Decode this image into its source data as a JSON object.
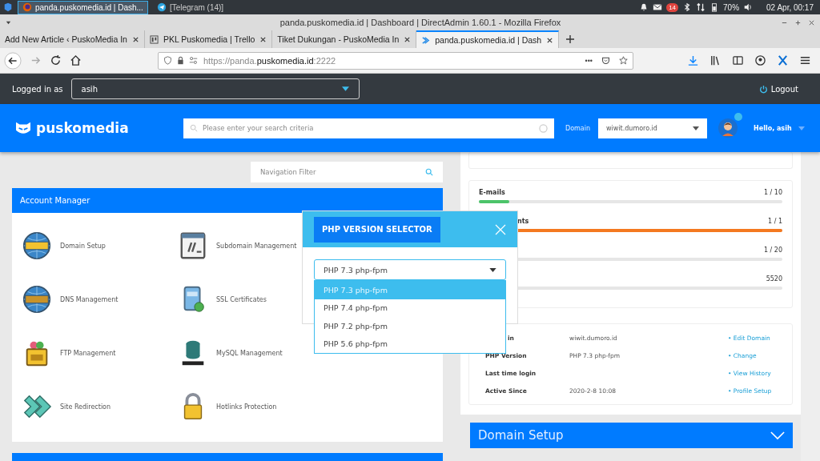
{
  "taskbar": {
    "tasks": [
      {
        "label": "panda.puskomedia.id | Dash...",
        "selected": true
      },
      {
        "label": "[Telegram (14)]",
        "selected": false
      }
    ],
    "notification_count": "14",
    "battery": "70%",
    "clock": "02 Apr, 00:17"
  },
  "window": {
    "title": "panda.puskomedia.id | Dashboard | DirectAdmin 1.60.1 - Mozilla Firefox"
  },
  "tabs": [
    {
      "label": "Add New Article ‹ PuskoMedia In",
      "selected": false
    },
    {
      "label": "PKL Puskomedia | Trello",
      "selected": false
    },
    {
      "label": "Tiket Dukungan - PuskoMedia In",
      "selected": false
    },
    {
      "label": "panda.puskomedia.id | Dash",
      "selected": true
    }
  ],
  "address_bar": {
    "url_start": "https://panda.",
    "url_domain": "puskomedia.id",
    "url_end": ":2222",
    "more": "•••"
  },
  "admin_bar": {
    "label": "Logged in as",
    "user": "asih",
    "logout": "Logout"
  },
  "header": {
    "brand": "puskomedia",
    "search_placeholder": "Please enter your search criteria",
    "domain_label": "Domain",
    "domain": "wiwit.dumoro.id",
    "greeting": "Hello, asih"
  },
  "navigation_filter": {
    "placeholder": "Navigation Filter"
  },
  "account_manager": {
    "title": "Account Manager",
    "items": [
      {
        "label": "Domain Setup",
        "kind": "www"
      },
      {
        "label": "Subdomain Management",
        "kind": "window"
      },
      {
        "label": "DNS Management",
        "kind": "dns"
      },
      {
        "label": "SSL Certificates",
        "kind": "ssl"
      },
      {
        "label": "FTP Management",
        "kind": "ftp"
      },
      {
        "label": "MySQL Management",
        "kind": "mysql"
      },
      {
        "label": "Site Redirection",
        "kind": "redirect"
      },
      {
        "label": "Hotlinks Protection",
        "kind": "lock"
      }
    ]
  },
  "usage": [
    {
      "label": "E-mails",
      "value": "1 / 10",
      "level": 0.1,
      "color": "#4cc46a"
    },
    {
      "label": "nts",
      "clipped": true,
      "value": "1 / 1",
      "level": 1,
      "color": "#f47920"
    },
    {
      "value": "1 / 20",
      "level": 0
    },
    {
      "value": "5520",
      "level": 0
    }
  ],
  "account_info": [
    {
      "label": "in",
      "clipped": true,
      "value": "wiwit.dumoro.id",
      "link": "• Edit Domain"
    },
    {
      "label": "PHP Version",
      "value": "PHP 7.3 php-fpm",
      "link": "• Change"
    },
    {
      "label": "Last time login",
      "link": "• View History"
    },
    {
      "label": "Active Since",
      "value": "2020-2-8 10:08",
      "link": "• Profile Setup"
    }
  ],
  "domain_setup_panel": {
    "title": "Domain Setup"
  },
  "modal": {
    "title": "PHP VERSION SELECTOR",
    "select": {
      "value": "PHP 7.3 php-fpm",
      "expanded": true
    },
    "options": [
      {
        "label": "PHP 7.3 php-fpm",
        "selected": true
      },
      {
        "label": "PHP 7.4 php-fpm",
        "selected": false
      },
      {
        "label": "PHP 7.2 php-fpm",
        "selected": false
      },
      {
        "label": "PHP 5.6 php-fpm",
        "selected": false
      }
    ]
  }
}
